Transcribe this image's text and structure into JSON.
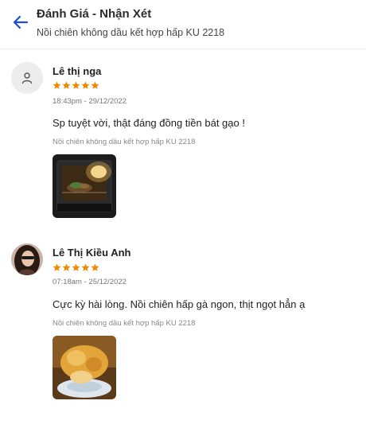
{
  "header": {
    "title": "Đánh Giá - Nhận Xét",
    "subtitle": "Nồi chiên không dầu kết hợp hấp KU 2218"
  },
  "reviews": [
    {
      "name": "Lê thị nga",
      "rating": 5,
      "timestamp": "18:43pm - 29/12/2022",
      "comment": "Sp tuyệt vời, thật đáng đồng tiền bát gạo !",
      "product": "Nồi chiên không dầu kết hợp hấp KU 2218"
    },
    {
      "name": "Lê Thị Kiều Anh",
      "rating": 5,
      "timestamp": "07:18am - 25/12/2022",
      "comment": "Cực kỳ hài lòng. Nồi chiên hấp gà ngon, thịt ngọt hẳn ạ",
      "product": "Nồi chiên không dầu kết hợp hấp KU 2218"
    }
  ],
  "colors": {
    "accent": "#1a4fd6",
    "star": "#f08a00"
  },
  "icons": {
    "back": "arrow-left-icon",
    "default_avatar": "user-icon",
    "star": "star-icon"
  }
}
